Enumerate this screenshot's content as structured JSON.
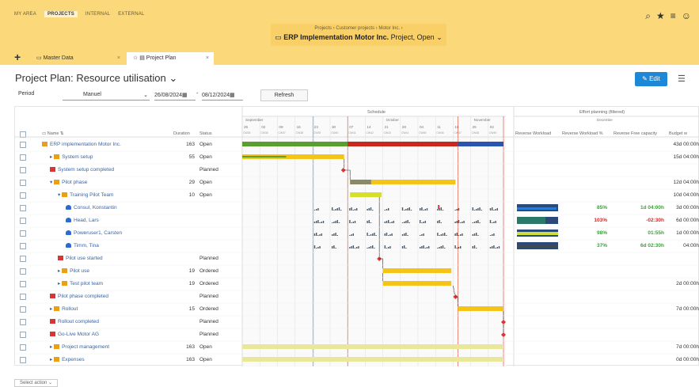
{
  "nav": {
    "items": [
      {
        "label": "MY AREA",
        "active": false
      },
      {
        "label": "PROJECTS",
        "active": true
      },
      {
        "label": "INTERNAL",
        "active": false
      },
      {
        "label": "EXTERNAL",
        "active": false
      }
    ]
  },
  "breadcrumb": {
    "path": "Projects  ›  Customer projects  ›  Motor Inc.  ›",
    "title_bold": "ERP Implementation Motor Inc.",
    "title_rest": " Project, Open"
  },
  "top_icons": [
    "search-icon",
    "star-icon",
    "menu-icon",
    "avatar-icon"
  ],
  "tabs": [
    {
      "label": "Master Data",
      "active": false
    },
    {
      "label": "Project Plan",
      "active": true
    }
  ],
  "page": {
    "title": "Project Plan: Resource utilisation",
    "edit_label": "Edit"
  },
  "toolbar": {
    "period_label": "Period",
    "period_mode": "Manuel",
    "date_from": "26/08/2024",
    "date_to": "08/12/2024",
    "refresh_label": "Refresh"
  },
  "columns": {
    "name": "Name",
    "duration": "Duration",
    "status": "Status",
    "schedule": "Schedule",
    "effort": "Effort planning (filtered)",
    "rev_workload": "Reverse Workload",
    "rev_workload_pct": "Reverse Workload %",
    "rev_free": "Reverse Free capacity",
    "budget": "Budget w"
  },
  "months": [
    "September",
    "October",
    "November",
    "Decembe"
  ],
  "days": [
    "26",
    "02",
    "09",
    "16",
    "23",
    "30",
    "07",
    "14",
    "21",
    "28",
    "04",
    "11",
    "18",
    "25",
    "02"
  ],
  "weeks": [
    "CW35",
    "CW36",
    "CW37",
    "CW38",
    "CW39",
    "CW40",
    "CW41",
    "CW42",
    "CW43",
    "CW44",
    "CW45",
    "CW46",
    "CW47",
    "CW48",
    "CW49"
  ],
  "rows": [
    {
      "name": "ERP implementation Motor Inc.",
      "indent": 0,
      "type": "project",
      "duration": "163",
      "status": "Open",
      "budget": "43d 00:00h"
    },
    {
      "name": "System setup",
      "indent": 1,
      "type": "folder",
      "duration": "55",
      "status": "Open",
      "budget": "15d 04:00h"
    },
    {
      "name": "System setup completed",
      "indent": 1,
      "type": "milestone",
      "duration": "",
      "status": "Planned",
      "budget": ""
    },
    {
      "name": "Pilot phase",
      "indent": 1,
      "type": "folder",
      "duration": "29",
      "status": "Open",
      "budget": "12d 04:00h"
    },
    {
      "name": "Training Pilot Team",
      "indent": 2,
      "type": "folder",
      "duration": "10",
      "status": "Open",
      "budget": "10d 04:00h"
    },
    {
      "name": "Consul, Konstantin",
      "indent": 3,
      "type": "person",
      "duration": "",
      "status": "",
      "budget": "3d 00:00h",
      "pct": "85%",
      "free": "1d 04:00h"
    },
    {
      "name": "Head, Lars",
      "indent": 3,
      "type": "person",
      "duration": "",
      "status": "",
      "budget": "6d 00:00h",
      "pct": "103%",
      "free": "-02:30h"
    },
    {
      "name": "Poweruser1, Carsten",
      "indent": 3,
      "type": "person",
      "duration": "",
      "status": "",
      "budget": "1d 00:00h",
      "pct": "98%",
      "free": "01:55h"
    },
    {
      "name": "Timm, Tina",
      "indent": 3,
      "type": "person",
      "duration": "",
      "status": "",
      "budget": "04:00h",
      "pct": "37%",
      "free": "6d 02:30h"
    },
    {
      "name": "Pilot use started",
      "indent": 2,
      "type": "milestone",
      "duration": "",
      "status": "Planned",
      "budget": ""
    },
    {
      "name": "Pilot use",
      "indent": 2,
      "type": "folder",
      "duration": "19",
      "status": "Ordered",
      "budget": ""
    },
    {
      "name": "Test pilot team",
      "indent": 2,
      "type": "folder",
      "duration": "19",
      "status": "Ordered",
      "budget": "2d 00:00h"
    },
    {
      "name": "Pilot phase completed",
      "indent": 1,
      "type": "milestone",
      "duration": "",
      "status": "Planned",
      "budget": ""
    },
    {
      "name": "Rollout",
      "indent": 1,
      "type": "folder",
      "duration": "15",
      "status": "Ordered",
      "budget": "7d 00:00h"
    },
    {
      "name": "Rollout completed",
      "indent": 1,
      "type": "milestone",
      "duration": "",
      "status": "Planned",
      "budget": ""
    },
    {
      "name": "Go-Live Motor AG",
      "indent": 1,
      "type": "milestone",
      "duration": "",
      "status": "Planned",
      "budget": ""
    },
    {
      "name": "Project management",
      "indent": 1,
      "type": "folder-pm",
      "duration": "163",
      "status": "Open",
      "budget": "7d 00:00h"
    },
    {
      "name": "Expenses",
      "indent": 1,
      "type": "folder-pm",
      "duration": "163",
      "status": "Open",
      "budget": "0d 00:00h"
    }
  ],
  "bottom": {
    "select_action": "Select action"
  },
  "colors": {
    "green": "#5a9e2f",
    "red": "#c8281e",
    "blue": "#2a54b0",
    "yellow": "#f4c518",
    "navy": "#2b4a7a",
    "lime": "#cfe03a",
    "pct_green": "#3aa23a",
    "pct_red": "#d02a2a"
  }
}
